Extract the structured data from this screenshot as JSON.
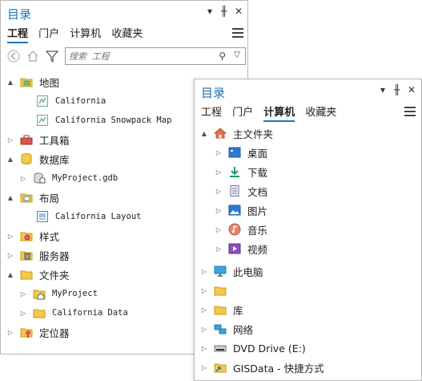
{
  "catalog": {
    "title": "目录",
    "tabs": [
      "工程",
      "门户",
      "计算机",
      "收藏夹"
    ],
    "active_tab": "工程",
    "search_placeholder": "搜索 工程",
    "tree": [
      {
        "label": "地图",
        "expander": "▲",
        "icon": "map-folder-icon"
      },
      {
        "label": "California",
        "expander": "",
        "icon": "map-icon"
      },
      {
        "label": "California Snowpack Map",
        "expander": "",
        "icon": "map-icon"
      },
      {
        "label": "工具箱",
        "expander": "▷",
        "icon": "toolbox-icon"
      },
      {
        "label": "数据库",
        "expander": "▲",
        "icon": "database-icon"
      },
      {
        "label": "MyProject.gdb",
        "expander": "▷",
        "icon": "geodatabase-icon"
      },
      {
        "label": "布局",
        "expander": "▲",
        "icon": "layout-folder-icon"
      },
      {
        "label": "California Layout",
        "expander": "",
        "icon": "layout-icon"
      },
      {
        "label": "样式",
        "expander": "▷",
        "icon": "styles-icon"
      },
      {
        "label": "服务器",
        "expander": "▷",
        "icon": "server-icon"
      },
      {
        "label": "文件夹",
        "expander": "▲",
        "icon": "folder-icon"
      },
      {
        "label": "MyProject",
        "expander": "▷",
        "icon": "home-folder-icon"
      },
      {
        "label": "California Data",
        "expander": "▷",
        "icon": "folder-icon"
      },
      {
        "label": "定位器",
        "expander": "▷",
        "icon": "locator-icon"
      }
    ]
  },
  "computer": {
    "title": "目录",
    "tabs": [
      "工程",
      "门户",
      "计算机",
      "收藏夹"
    ],
    "active_tab": "计算机",
    "tree": [
      {
        "label": "主文件夹",
        "expander": "▲",
        "icon": "home-icon"
      },
      {
        "label": "桌面",
        "expander": "▷",
        "icon": "desktop-icon"
      },
      {
        "label": "下载",
        "expander": "▷",
        "icon": "download-icon"
      },
      {
        "label": "文档",
        "expander": "▷",
        "icon": "documents-icon"
      },
      {
        "label": "图片",
        "expander": "▷",
        "icon": "pictures-icon"
      },
      {
        "label": "音乐",
        "expander": "▷",
        "icon": "music-icon"
      },
      {
        "label": "视频",
        "expander": "▷",
        "icon": "videos-icon"
      },
      {
        "label": "此电脑",
        "expander": "▷",
        "icon": "this-pc-icon"
      },
      {
        "label": "",
        "expander": "▷",
        "icon": "folder-icon"
      },
      {
        "label": "库",
        "expander": "▷",
        "icon": "library-icon"
      },
      {
        "label": "网络",
        "expander": "▷",
        "icon": "network-icon"
      },
      {
        "label": "DVD Drive (E:)",
        "expander": "▷",
        "icon": "dvd-drive-icon"
      },
      {
        "label": "GISData - 快捷方式",
        "expander": "▷",
        "icon": "shortcut-folder-icon"
      }
    ]
  },
  "window_controls": {
    "dropdown": "▾",
    "pin": "╫",
    "close": "✕"
  }
}
